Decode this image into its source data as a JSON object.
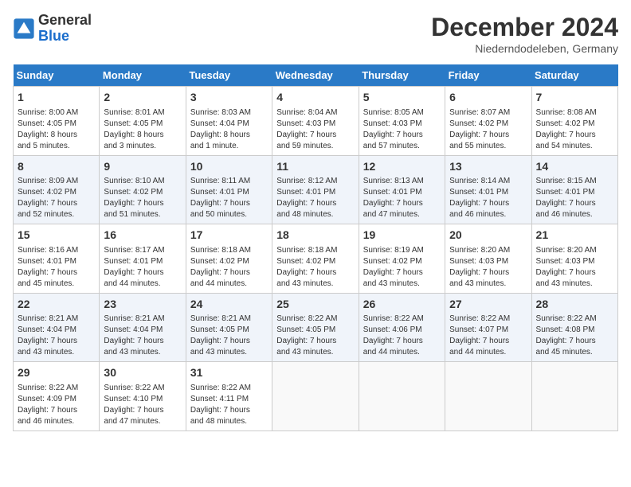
{
  "header": {
    "logo_line1": "General",
    "logo_line2": "Blue",
    "month_title": "December 2024",
    "location": "Niederndodeleben, Germany"
  },
  "days_of_week": [
    "Sunday",
    "Monday",
    "Tuesday",
    "Wednesday",
    "Thursday",
    "Friday",
    "Saturday"
  ],
  "weeks": [
    [
      {
        "day": "1",
        "info": "Sunrise: 8:00 AM\nSunset: 4:05 PM\nDaylight: 8 hours\nand 5 minutes."
      },
      {
        "day": "2",
        "info": "Sunrise: 8:01 AM\nSunset: 4:05 PM\nDaylight: 8 hours\nand 3 minutes."
      },
      {
        "day": "3",
        "info": "Sunrise: 8:03 AM\nSunset: 4:04 PM\nDaylight: 8 hours\nand 1 minute."
      },
      {
        "day": "4",
        "info": "Sunrise: 8:04 AM\nSunset: 4:03 PM\nDaylight: 7 hours\nand 59 minutes."
      },
      {
        "day": "5",
        "info": "Sunrise: 8:05 AM\nSunset: 4:03 PM\nDaylight: 7 hours\nand 57 minutes."
      },
      {
        "day": "6",
        "info": "Sunrise: 8:07 AM\nSunset: 4:02 PM\nDaylight: 7 hours\nand 55 minutes."
      },
      {
        "day": "7",
        "info": "Sunrise: 8:08 AM\nSunset: 4:02 PM\nDaylight: 7 hours\nand 54 minutes."
      }
    ],
    [
      {
        "day": "8",
        "info": "Sunrise: 8:09 AM\nSunset: 4:02 PM\nDaylight: 7 hours\nand 52 minutes."
      },
      {
        "day": "9",
        "info": "Sunrise: 8:10 AM\nSunset: 4:02 PM\nDaylight: 7 hours\nand 51 minutes."
      },
      {
        "day": "10",
        "info": "Sunrise: 8:11 AM\nSunset: 4:01 PM\nDaylight: 7 hours\nand 50 minutes."
      },
      {
        "day": "11",
        "info": "Sunrise: 8:12 AM\nSunset: 4:01 PM\nDaylight: 7 hours\nand 48 minutes."
      },
      {
        "day": "12",
        "info": "Sunrise: 8:13 AM\nSunset: 4:01 PM\nDaylight: 7 hours\nand 47 minutes."
      },
      {
        "day": "13",
        "info": "Sunrise: 8:14 AM\nSunset: 4:01 PM\nDaylight: 7 hours\nand 46 minutes."
      },
      {
        "day": "14",
        "info": "Sunrise: 8:15 AM\nSunset: 4:01 PM\nDaylight: 7 hours\nand 46 minutes."
      }
    ],
    [
      {
        "day": "15",
        "info": "Sunrise: 8:16 AM\nSunset: 4:01 PM\nDaylight: 7 hours\nand 45 minutes."
      },
      {
        "day": "16",
        "info": "Sunrise: 8:17 AM\nSunset: 4:01 PM\nDaylight: 7 hours\nand 44 minutes."
      },
      {
        "day": "17",
        "info": "Sunrise: 8:18 AM\nSunset: 4:02 PM\nDaylight: 7 hours\nand 44 minutes."
      },
      {
        "day": "18",
        "info": "Sunrise: 8:18 AM\nSunset: 4:02 PM\nDaylight: 7 hours\nand 43 minutes."
      },
      {
        "day": "19",
        "info": "Sunrise: 8:19 AM\nSunset: 4:02 PM\nDaylight: 7 hours\nand 43 minutes."
      },
      {
        "day": "20",
        "info": "Sunrise: 8:20 AM\nSunset: 4:03 PM\nDaylight: 7 hours\nand 43 minutes."
      },
      {
        "day": "21",
        "info": "Sunrise: 8:20 AM\nSunset: 4:03 PM\nDaylight: 7 hours\nand 43 minutes."
      }
    ],
    [
      {
        "day": "22",
        "info": "Sunrise: 8:21 AM\nSunset: 4:04 PM\nDaylight: 7 hours\nand 43 minutes."
      },
      {
        "day": "23",
        "info": "Sunrise: 8:21 AM\nSunset: 4:04 PM\nDaylight: 7 hours\nand 43 minutes."
      },
      {
        "day": "24",
        "info": "Sunrise: 8:21 AM\nSunset: 4:05 PM\nDaylight: 7 hours\nand 43 minutes."
      },
      {
        "day": "25",
        "info": "Sunrise: 8:22 AM\nSunset: 4:05 PM\nDaylight: 7 hours\nand 43 minutes."
      },
      {
        "day": "26",
        "info": "Sunrise: 8:22 AM\nSunset: 4:06 PM\nDaylight: 7 hours\nand 44 minutes."
      },
      {
        "day": "27",
        "info": "Sunrise: 8:22 AM\nSunset: 4:07 PM\nDaylight: 7 hours\nand 44 minutes."
      },
      {
        "day": "28",
        "info": "Sunrise: 8:22 AM\nSunset: 4:08 PM\nDaylight: 7 hours\nand 45 minutes."
      }
    ],
    [
      {
        "day": "29",
        "info": "Sunrise: 8:22 AM\nSunset: 4:09 PM\nDaylight: 7 hours\nand 46 minutes."
      },
      {
        "day": "30",
        "info": "Sunrise: 8:22 AM\nSunset: 4:10 PM\nDaylight: 7 hours\nand 47 minutes."
      },
      {
        "day": "31",
        "info": "Sunrise: 8:22 AM\nSunset: 4:11 PM\nDaylight: 7 hours\nand 48 minutes."
      },
      {
        "day": "",
        "info": ""
      },
      {
        "day": "",
        "info": ""
      },
      {
        "day": "",
        "info": ""
      },
      {
        "day": "",
        "info": ""
      }
    ]
  ]
}
